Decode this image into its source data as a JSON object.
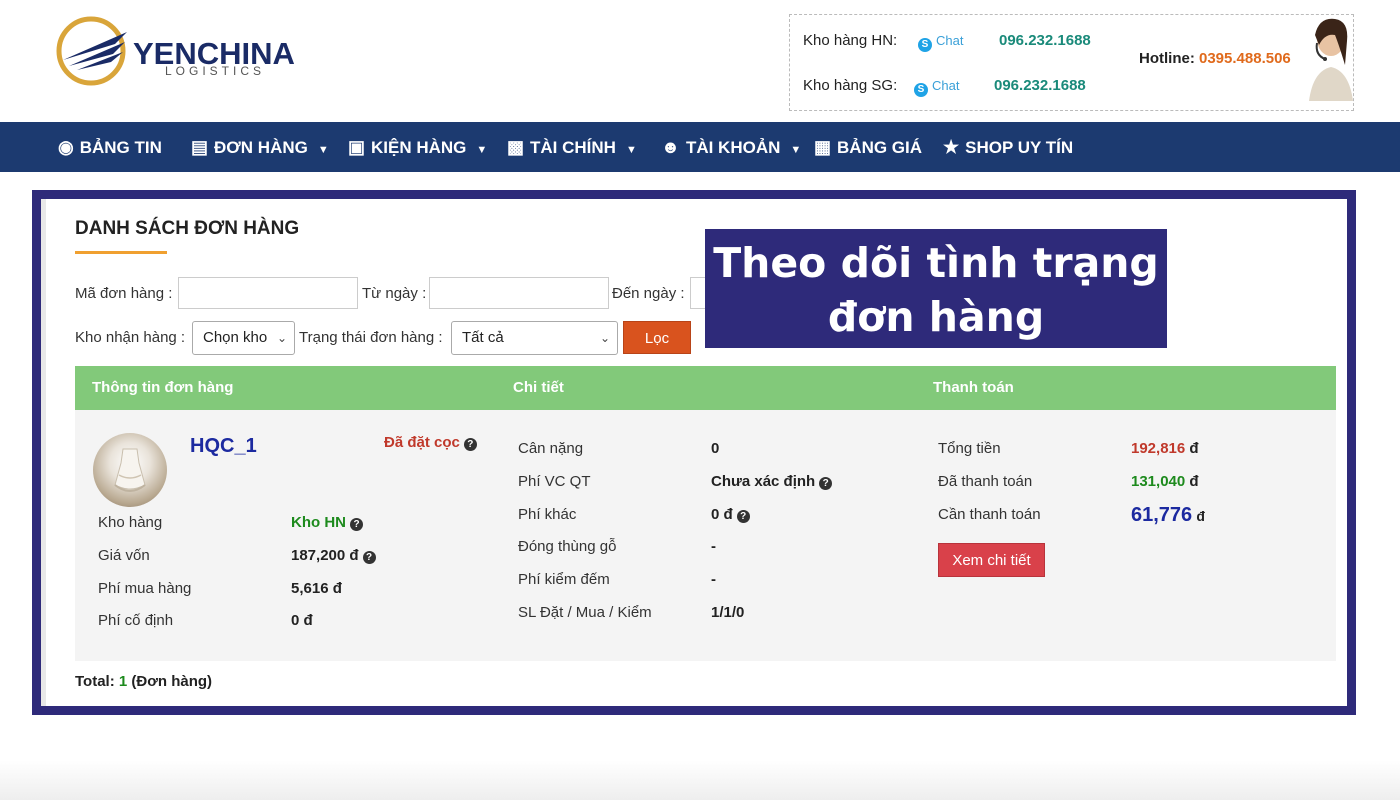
{
  "brand": {
    "name": "YENCHINA",
    "sub": "LOGISTICS"
  },
  "contact": {
    "hn_label": "Kho hàng HN:",
    "sg_label": "Kho hàng SG:",
    "chat_label": "Chat",
    "hn_phone": "096.232.1688",
    "sg_phone": "096.232.1688",
    "hotline_label": "Hotline:",
    "hotline_number": "0395.488.506"
  },
  "nav": {
    "items": [
      {
        "label": "BẢNG TIN",
        "icon": "dashboard-icon"
      },
      {
        "label": "ĐƠN HÀNG",
        "icon": "document-icon",
        "dropdown": true
      },
      {
        "label": "KIỆN HÀNG",
        "icon": "box-icon",
        "dropdown": true
      },
      {
        "label": "TÀI CHÍNH",
        "icon": "money-icon",
        "dropdown": true
      },
      {
        "label": "TÀI KHOẢN",
        "icon": "user-icon",
        "dropdown": true
      },
      {
        "label": "BẢNG GIÁ",
        "icon": "building-icon"
      },
      {
        "label": "SHOP UY TÍN",
        "icon": "star-icon"
      }
    ]
  },
  "page": {
    "title": "DANH SÁCH ĐƠN HÀNG",
    "banner_line1": "Theo dõi tình trạng",
    "banner_line2": "đơn hàng"
  },
  "filters": {
    "order_code_label": "Mã đơn hàng :",
    "order_code_value": "",
    "from_label": "Từ ngày :",
    "from_value": "",
    "to_label": "Đến ngày :",
    "to_value": "",
    "warehouse_label": "Kho nhận hàng :",
    "warehouse_value": "Chọn kho",
    "status_label": "Trạng thái đơn hàng :",
    "status_value": "Tất cả",
    "filter_button": "Lọc"
  },
  "table": {
    "headers": [
      "Thông tin đơn hàng",
      "Chi tiết",
      "Thanh toán"
    ]
  },
  "order": {
    "code": "HQC_1",
    "status": "Đã đặt cọc",
    "info": [
      {
        "label": "Kho hàng",
        "value": "Kho HN"
      },
      {
        "label": "Giá vốn",
        "value": "187,200 đ"
      },
      {
        "label": "Phí mua hàng",
        "value": "5,616 đ"
      },
      {
        "label": "Phí cố định",
        "value": "0 đ"
      }
    ],
    "details": [
      {
        "label": "Cân nặng",
        "value": "0"
      },
      {
        "label": "Phí VC QT",
        "value": "Chưa xác định"
      },
      {
        "label": "Phí khác",
        "value": "0 đ"
      },
      {
        "label": "Đóng thùng gỗ",
        "value": "-"
      },
      {
        "label": "Phí kiểm đếm",
        "value": "-"
      },
      {
        "label": "SL Đặt / Mua / Kiểm",
        "value": "1/1/0"
      }
    ],
    "payment": [
      {
        "label": "Tổng tiền",
        "value": "192,816",
        "unit": "đ"
      },
      {
        "label": "Đã thanh toán",
        "value": "131,040",
        "unit": "đ"
      },
      {
        "label": "Cần thanh toán",
        "value": "61,776",
        "unit": "đ"
      }
    ],
    "detail_button": "Xem chi tiết"
  },
  "footer": {
    "total_label": "Total:",
    "total_count": "1",
    "total_unit": "(Đơn hàng)"
  },
  "colors": {
    "nav_bg": "#1c3a70",
    "frame": "#2e2a7a",
    "table_header": "#82c97a",
    "filter_button": "#d9531e",
    "detail_button": "#d9414a"
  }
}
